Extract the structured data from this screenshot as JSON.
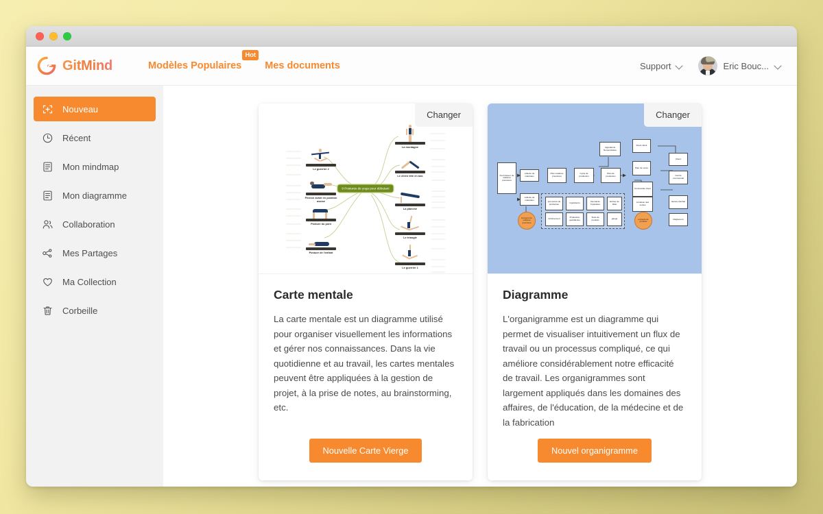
{
  "window": {
    "traffic_lights": [
      "close",
      "minimize",
      "maximize"
    ]
  },
  "header": {
    "brand_name": "GitMind",
    "brand_icon": "gitmind-logo-icon",
    "nav": [
      {
        "label": "Modèles Populaires",
        "badge": "Hot"
      },
      {
        "label": "Mes documents",
        "badge": ""
      }
    ],
    "support_label": "Support",
    "user_name": "Eric Bouc...",
    "accent_color": "#f7892f"
  },
  "sidebar": {
    "items": [
      {
        "label": "Nouveau",
        "icon": "new-plus-frame-icon",
        "active": true
      },
      {
        "label": "Récent",
        "icon": "clock-icon",
        "active": false
      },
      {
        "label": "Mon mindmap",
        "icon": "document-lines-icon",
        "active": false
      },
      {
        "label": "Mon diagramme",
        "icon": "document-lines-icon",
        "active": false
      },
      {
        "label": "Collaboration",
        "icon": "people-icon",
        "active": false
      },
      {
        "label": "Mes Partages",
        "icon": "share-nodes-icon",
        "active": false
      },
      {
        "label": "Ma Collection",
        "icon": "heart-icon",
        "active": false
      },
      {
        "label": "Corbeille",
        "icon": "trash-icon",
        "active": false
      }
    ]
  },
  "cards": [
    {
      "id": "mindmap",
      "changer_label": "Changer",
      "title": "Carte mentale",
      "description": "La carte mentale est un diagramme utilisé pour organiser visuellement les informations et gérer nos connaissances. Dans la vie quotidienne et au travail, les cartes mentales peuvent être appliquées à la gestion de projet, à la prise de notes, au brainstorming, etc.",
      "cta_label": "Nouvelle Carte Vierge",
      "thumbnail": {
        "kind": "mindmap",
        "background": "#ffffff",
        "center_node": "9 Postures de yoga pour débutant",
        "center_color": "#6e8b1e",
        "left_nodes": [
          "Le guerrier 2",
          "Flexion avant en position assise",
          "Posture du pont",
          "Posture de l'enfant"
        ],
        "right_nodes": [
          "La montagne",
          "Le chien tête en bas",
          "La planche",
          "Le triangle",
          "Le guerrier 1"
        ]
      }
    },
    {
      "id": "diagram",
      "changer_label": "Changer",
      "title": "Diagramme",
      "description": "L'organigramme est un diagramme qui permet de visualiser intuitivement un flux de travail ou un processus compliqué, ce qui améliore considérablement notre efficacité de travail. Les organigrammes sont largement appliqués dans les domaines des affaires, de l'éducation, de la médecine et de la fabrication",
      "cta_label": "Nouvel organigramme",
      "thumbnail": {
        "kind": "flowchart",
        "background": "#a8c3ea",
        "nodes": [
          "Fournisseur de matières premières",
          "collecte de matériaux",
          "collecte de matériaux",
          "Plan matières premières",
          "Cycle de production",
          "Plan de production",
          "Ingrédients Nomenclature",
          "Plan de vente",
          "Devis client",
          "Client",
          "Centre commercial",
          "Commande client",
          "Livraison des ventes",
          "facture d'achat",
          "Règlement",
          "processus de production",
          "Ingrédients",
          "Demande l'opération",
          "Entrée de billet",
          "Achèvement",
          "Production quotidienne",
          "Tests de produits",
          "gauge"
        ],
        "highlight_nodes": [
          "Entrepôt de matières premières",
          "entrepôt de produits"
        ],
        "highlight_color": "#f0a050"
      }
    }
  ]
}
